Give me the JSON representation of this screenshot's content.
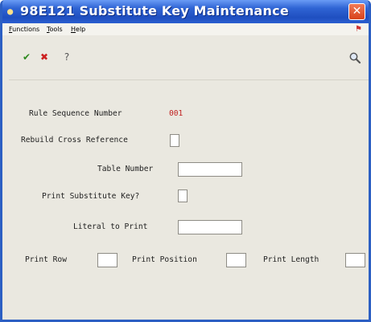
{
  "window": {
    "title": "98E121   Substitute Key Maintenance",
    "close_glyph": "✕"
  },
  "menu": {
    "items": [
      "Functions",
      "Tools",
      "Help"
    ]
  },
  "toolbar": {
    "ok_glyph": "✔",
    "cancel_glyph": "✖",
    "help_glyph": "?"
  },
  "form": {
    "rule_sequence_number": {
      "label": "Rule Sequence Number",
      "value": "001"
    },
    "rebuild_cross_reference": {
      "label": "Rebuild Cross Reference",
      "checked": false
    },
    "table_number": {
      "label": "Table Number",
      "value": ""
    },
    "print_substitute_key": {
      "label": "Print Substitute Key?",
      "checked": false
    },
    "literal_to_print": {
      "label": "Literal to Print",
      "value": ""
    },
    "print_row": {
      "label": "Print Row",
      "value": ""
    },
    "print_position": {
      "label": "Print Position",
      "value": ""
    },
    "print_length": {
      "label": "Print Length",
      "value": ""
    }
  },
  "colors": {
    "title_bar": "#2f64d4",
    "close_button": "#d8421a",
    "window_body": "#eae8e0",
    "value_text": "#c02020"
  }
}
